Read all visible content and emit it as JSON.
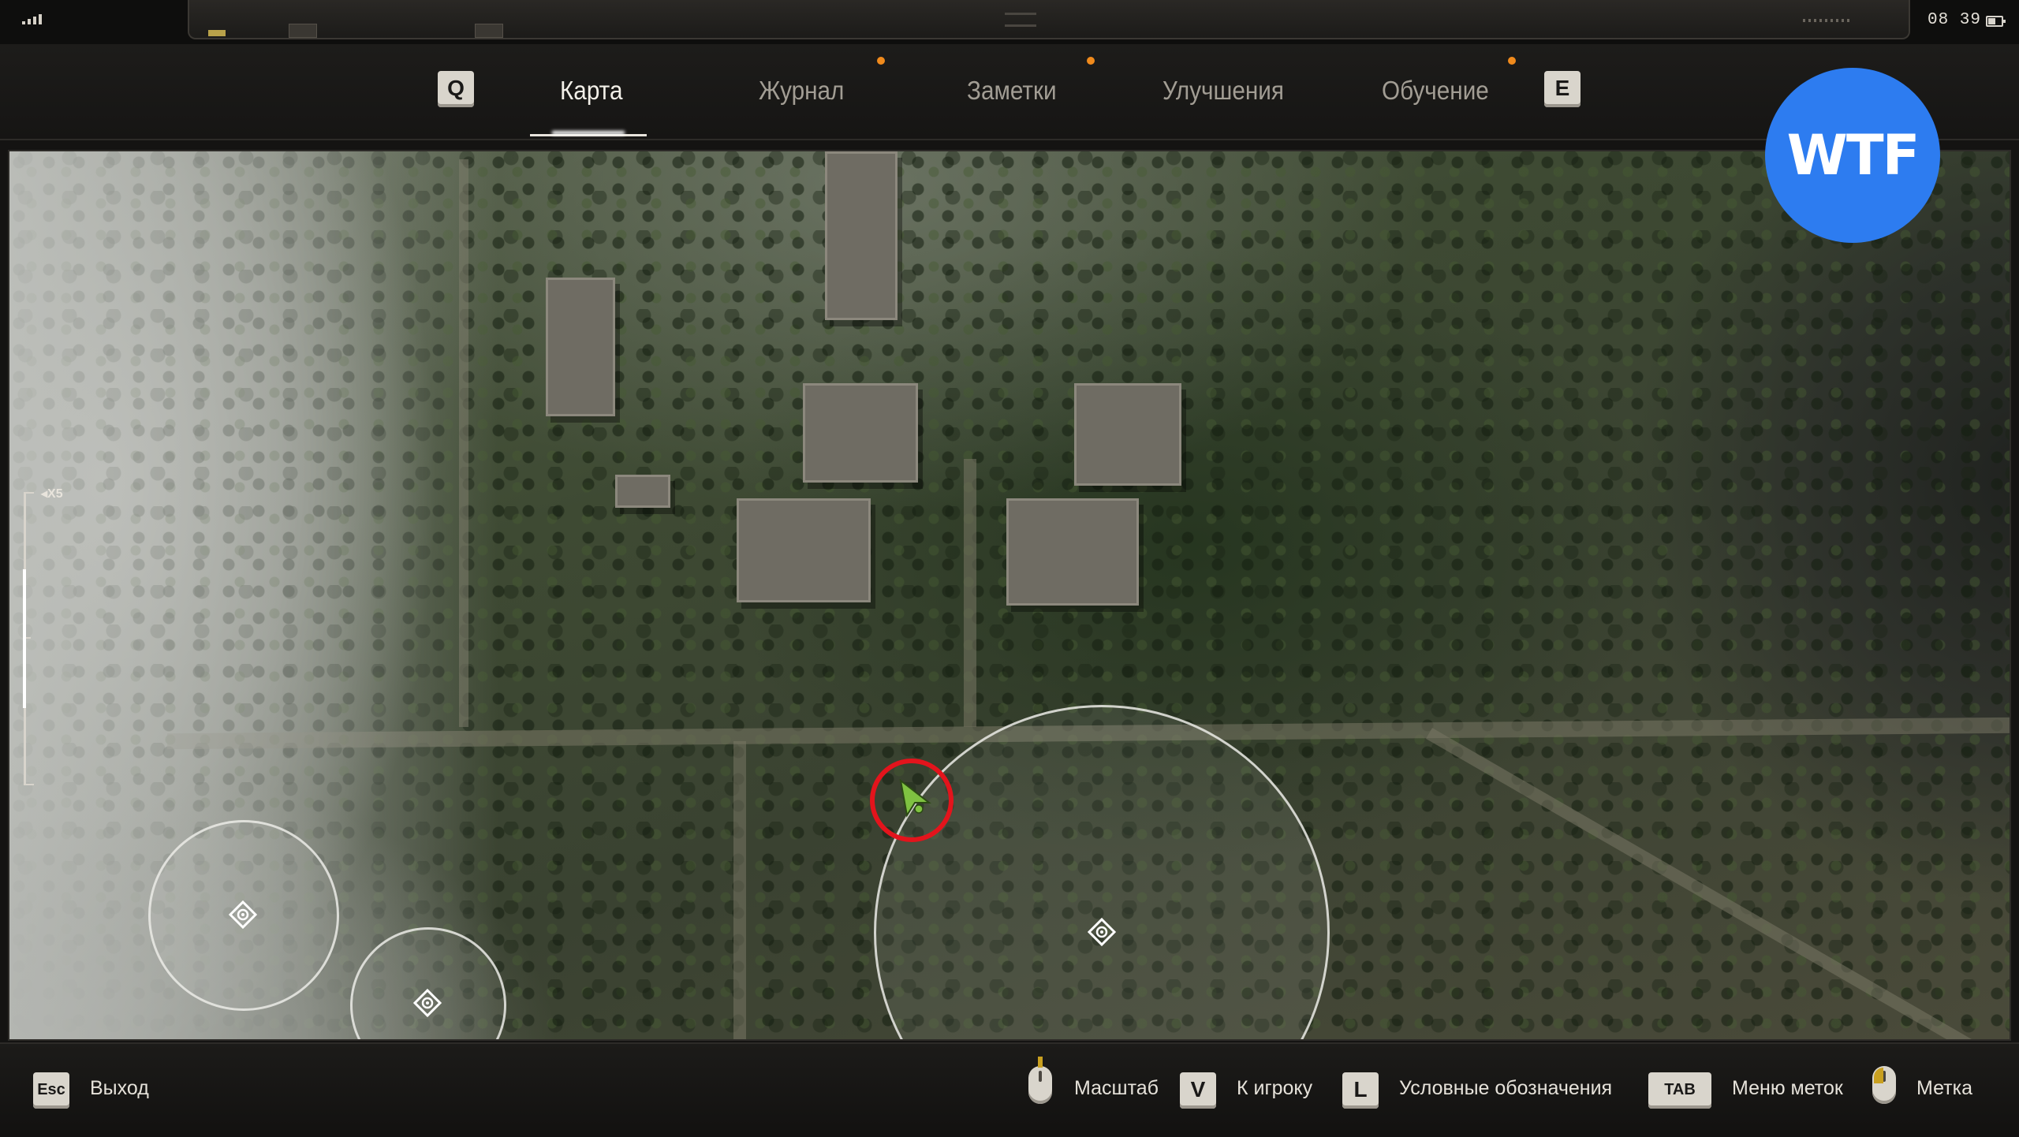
{
  "status": {
    "time": "08 39"
  },
  "tabs": {
    "left_key": "Q",
    "right_key": "E",
    "items": [
      {
        "label": "Карта",
        "active": true,
        "notify": false
      },
      {
        "label": "Журнал",
        "active": false,
        "notify": true
      },
      {
        "label": "Заметки",
        "active": false,
        "notify": true
      },
      {
        "label": "Улучшения",
        "active": false,
        "notify": false
      },
      {
        "label": "Обучение",
        "active": false,
        "notify": true
      }
    ]
  },
  "map": {
    "zoom_label": "X5",
    "player_marker_color": "#e3141c",
    "player_icon_color": "#7fc241",
    "poi_icon": "target-diamond-icon"
  },
  "badge": {
    "text": "WTF",
    "color": "#2d7cf0"
  },
  "hints": {
    "exit_key": "Esc",
    "exit_label": "Выход",
    "zoom_label": "Масштаб",
    "to_player_key": "V",
    "to_player_label": "К игроку",
    "legend_key": "L",
    "legend_label": "Условные обозначения",
    "marks_menu_key": "TAB",
    "marks_menu_label": "Меню меток",
    "mark_label": "Метка"
  },
  "colors": {
    "notify_dot": "#f08a1c",
    "key_cap": "#d9d5cc"
  }
}
